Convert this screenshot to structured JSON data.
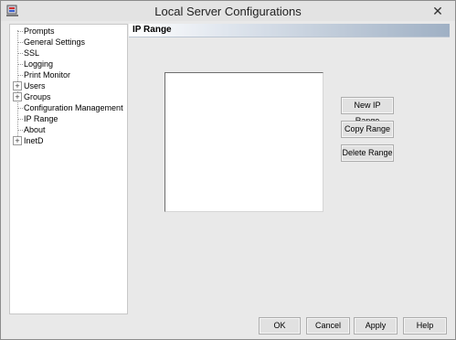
{
  "window": {
    "title": "Local Server Configurations",
    "close_glyph": "✕"
  },
  "tree": {
    "items": [
      {
        "label": "Prompts",
        "expandable": false
      },
      {
        "label": "General Settings",
        "expandable": false
      },
      {
        "label": "SSL",
        "expandable": false
      },
      {
        "label": "Logging",
        "expandable": false
      },
      {
        "label": "Print Monitor",
        "expandable": false
      },
      {
        "label": "Users",
        "expandable": true
      },
      {
        "label": "Groups",
        "expandable": true
      },
      {
        "label": "Configuration Management",
        "expandable": false
      },
      {
        "label": "IP Range",
        "expandable": false
      },
      {
        "label": "About",
        "expandable": false
      },
      {
        "label": "InetD",
        "expandable": true
      }
    ],
    "expander_glyph": "+"
  },
  "panel": {
    "title": "IP Range",
    "buttons": {
      "new": "New IP Range",
      "copy": "Copy Range",
      "delete": "Delete Range"
    }
  },
  "footer": {
    "ok": "OK",
    "cancel": "Cancel",
    "apply": "Apply",
    "help": "Help"
  },
  "colors": {
    "accent": "#9fb0c4"
  }
}
